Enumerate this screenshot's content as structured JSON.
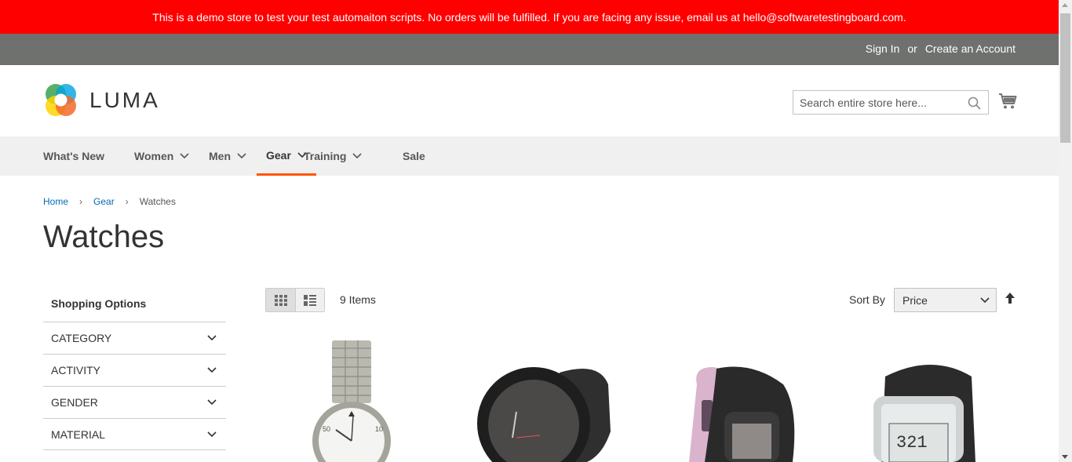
{
  "banner": {
    "text": "This is a demo store to test your test automaiton scripts. No orders will be fulfilled. If you are facing any issue, email us at hello@softwaretestingboard.com."
  },
  "header_links": {
    "sign_in": "Sign In",
    "or": "or",
    "create_account": "Create an Account"
  },
  "logo": {
    "text": "LUMA"
  },
  "search": {
    "placeholder": "Search entire store here..."
  },
  "nav": {
    "items": [
      {
        "label": "What's New",
        "dropdown": false
      },
      {
        "label": "Women",
        "dropdown": true
      },
      {
        "label": "Men",
        "dropdown": true
      },
      {
        "label": "Gear",
        "dropdown": true,
        "active": true
      },
      {
        "label": "Training",
        "dropdown": true
      },
      {
        "label": "Sale",
        "dropdown": false
      }
    ]
  },
  "breadcrumb": {
    "items": [
      "Home",
      "Gear"
    ],
    "current": "Watches"
  },
  "page": {
    "title": "Watches"
  },
  "sidebar": {
    "title": "Shopping Options",
    "filters": [
      "CATEGORY",
      "ACTIVITY",
      "GENDER",
      "MATERIAL"
    ]
  },
  "toolbar": {
    "item_count": "9 Items",
    "sort_label": "Sort By",
    "sort_value": "Price"
  },
  "colors": {
    "banner": "#ff0000",
    "topbar": "#6e716e",
    "nav_bg": "#f0f0f0",
    "accent": "#ff5501",
    "link": "#006bb4"
  },
  "products": [
    {
      "image": "silver-metal-watch"
    },
    {
      "image": "black-sport-watch"
    },
    {
      "image": "pink-black-digital-watch"
    },
    {
      "image": "black-digital-chronograph-watch"
    }
  ]
}
